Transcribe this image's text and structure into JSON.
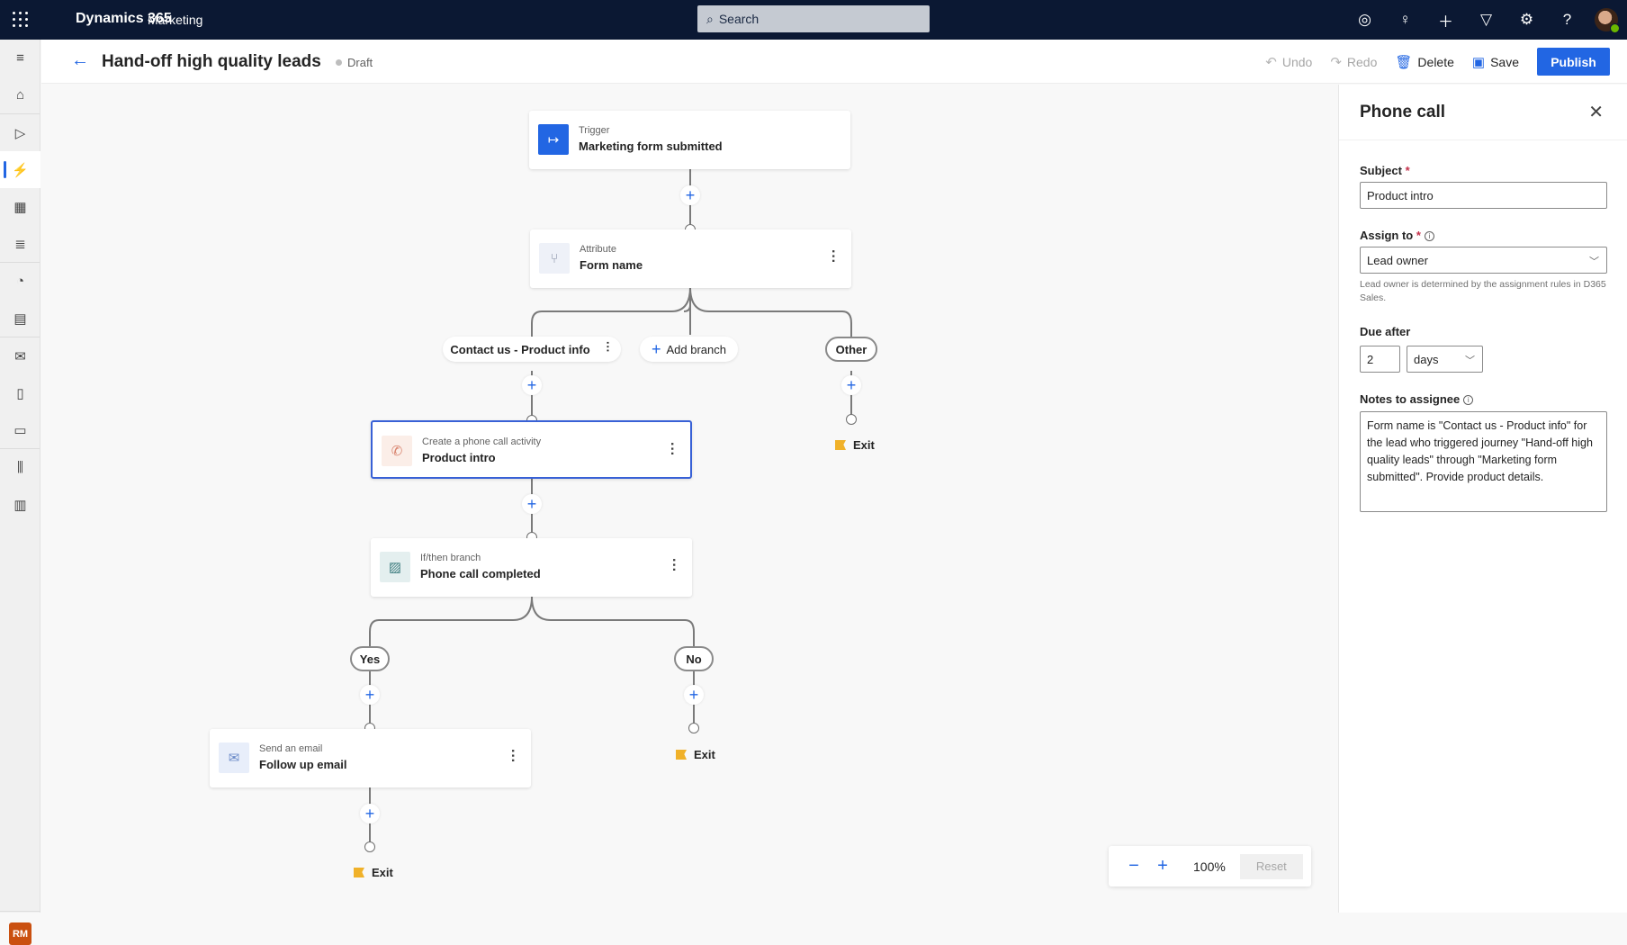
{
  "topbar": {
    "brand": "Dynamics 365",
    "app": "Marketing",
    "search_placeholder": "Search",
    "icons": [
      "target-icon",
      "lightbulb-icon",
      "add-icon",
      "filter-icon",
      "settings-icon",
      "help-icon"
    ]
  },
  "sidebar": {
    "items": [
      {
        "name": "menu",
        "glyph": "≡"
      },
      {
        "name": "home",
        "glyph": "⌂"
      },
      {
        "name": "get-started",
        "glyph": "▷"
      },
      {
        "name": "journeys",
        "glyph": "⚡",
        "active": true
      },
      {
        "name": "segments",
        "glyph": "▦"
      },
      {
        "name": "triggers",
        "glyph": "≣"
      },
      {
        "name": "analytics",
        "glyph": "◔"
      },
      {
        "name": "forms",
        "glyph": "▤"
      },
      {
        "name": "email",
        "glyph": "✉"
      },
      {
        "name": "push",
        "glyph": "▯"
      },
      {
        "name": "sms",
        "glyph": "▭"
      },
      {
        "name": "library",
        "glyph": "⫼"
      },
      {
        "name": "assets",
        "glyph": "▥"
      }
    ],
    "user_initials": "RM"
  },
  "header": {
    "title": "Hand-off high quality leads",
    "status": "Draft",
    "undo": "Undo",
    "redo": "Redo",
    "delete": "Delete",
    "save": "Save",
    "publish": "Publish"
  },
  "canvas": {
    "trigger": {
      "kind": "Trigger",
      "value": "Marketing form submitted"
    },
    "attribute": {
      "kind": "Attribute",
      "value": "Form name"
    },
    "branches": {
      "first": "Contact us - Product info",
      "add": "Add branch",
      "other": "Other"
    },
    "phone": {
      "kind": "Create a phone call activity",
      "value": "Product intro"
    },
    "ifthen": {
      "kind": "If/then branch",
      "value": "Phone call completed"
    },
    "yes": "Yes",
    "no": "No",
    "email": {
      "kind": "Send an email",
      "value": "Follow up email"
    },
    "exit": "Exit"
  },
  "zoom": {
    "level": "100%",
    "reset": "Reset"
  },
  "panel": {
    "title": "Phone call",
    "subject_label": "Subject",
    "subject_value": "Product intro",
    "assign_label": "Assign to",
    "assign_value": "Lead owner",
    "assign_hint": "Lead owner is determined by the assignment rules in D365 Sales.",
    "due_label": "Due after",
    "due_value": "2",
    "due_unit": "days",
    "notes_label": "Notes to assignee",
    "notes_value": "Form name is \"Contact us - Product info\" for the lead who triggered journey \"Hand-off high quality leads\" through \"Marketing form submitted\". Provide product details."
  }
}
